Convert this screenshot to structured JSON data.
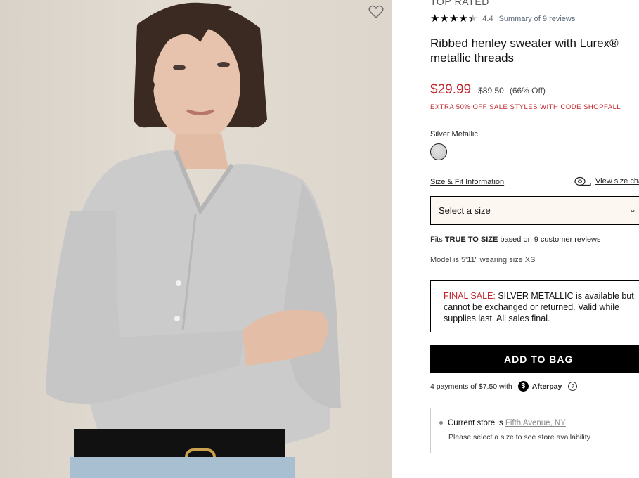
{
  "product": {
    "badge": "TOP RATED",
    "rating_value": "4.4",
    "stars_filled": 4.4,
    "reviews_link": "Summary of 9 reviews",
    "title": "Ribbed henley sweater with Lurex® metallic threads",
    "price": "$29.99",
    "original_price": "$89.50",
    "discount": "(66% Off)",
    "promo": "EXTRA 50% OFF SALE STYLES WITH CODE SHOPFALL",
    "color_label": "Silver Metallic",
    "swatch_color": "#cfcfcf",
    "size_fit_link": "Size & Fit Information",
    "view_size_chart": "View size cha",
    "size_select_placeholder": "Select a size",
    "fits_prefix": "Fits ",
    "fits_strong": "TRUE TO SIZE",
    "fits_middle": " based on ",
    "fits_link": "9 customer reviews",
    "model_info": "Model is 5'11\" wearing size XS",
    "final_sale_label": "FINAL SALE:",
    "final_sale_text": " SILVER METALLIC is available but cannot be exchanged or returned. Valid while supplies last. All sales final.",
    "add_to_bag": "ADD TO BAG",
    "afterpay_text": "4 payments of $7.50 with",
    "afterpay_brand": "Afterpay",
    "store_label": "Current store is ",
    "store_link": "Fifth Avenue, NY",
    "store_note": "Please select a size to see store availability"
  },
  "colors": {
    "sale_red": "#c0282e",
    "button_bg": "#000000",
    "select_bg": "#fdf7f2"
  },
  "icons": {
    "favorite": "heart-outline-icon",
    "size_chart": "measuring-tape-icon",
    "afterpay": "afterpay-logo-icon",
    "info": "info-circle-icon",
    "select": "chevron-down-icon"
  }
}
